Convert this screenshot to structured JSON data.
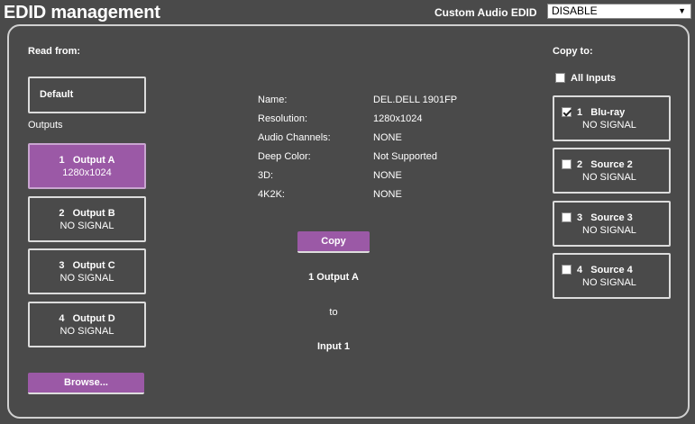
{
  "header": {
    "title": "EDID management",
    "audio_label": "Custom Audio EDID",
    "audio_value": "DISABLE"
  },
  "left": {
    "read_from_label": "Read from:",
    "default_label": "Default",
    "outputs_label": "Outputs",
    "outputs": [
      {
        "num": "1",
        "name": "Output A",
        "signal": "1280x1024",
        "selected": true
      },
      {
        "num": "2",
        "name": "Output B",
        "signal": "NO SIGNAL",
        "selected": false
      },
      {
        "num": "3",
        "name": "Output C",
        "signal": "NO SIGNAL",
        "selected": false
      },
      {
        "num": "4",
        "name": "Output D",
        "signal": "NO SIGNAL",
        "selected": false
      }
    ],
    "browse_label": "Browse..."
  },
  "info": {
    "rows": [
      {
        "key": "Name:",
        "value": "DEL.DELL 1901FP"
      },
      {
        "key": "Resolution:",
        "value": "1280x1024"
      },
      {
        "key": "Audio Channels:",
        "value": "NONE"
      },
      {
        "key": "Deep Color:",
        "value": "Not Supported"
      },
      {
        "key": "3D:",
        "value": "NONE"
      },
      {
        "key": "4K2K:",
        "value": "NONE"
      }
    ],
    "copy_label": "Copy",
    "copy_source": "1 Output A",
    "copy_to": "to",
    "copy_target": "Input 1"
  },
  "right": {
    "copy_to_label": "Copy to:",
    "all_inputs_label": "All Inputs",
    "all_inputs_checked": false,
    "inputs": [
      {
        "num": "1",
        "name": "Blu-ray",
        "signal": "NO SIGNAL",
        "checked": true
      },
      {
        "num": "2",
        "name": "Source 2",
        "signal": "NO SIGNAL",
        "checked": false
      },
      {
        "num": "3",
        "name": "Source 3",
        "signal": "NO SIGNAL",
        "checked": false
      },
      {
        "num": "4",
        "name": "Source 4",
        "signal": "NO SIGNAL",
        "checked": false
      }
    ]
  },
  "colors": {
    "background": "#4a4a4a",
    "accent": "#9b59a6",
    "border": "#dcdcdc"
  }
}
